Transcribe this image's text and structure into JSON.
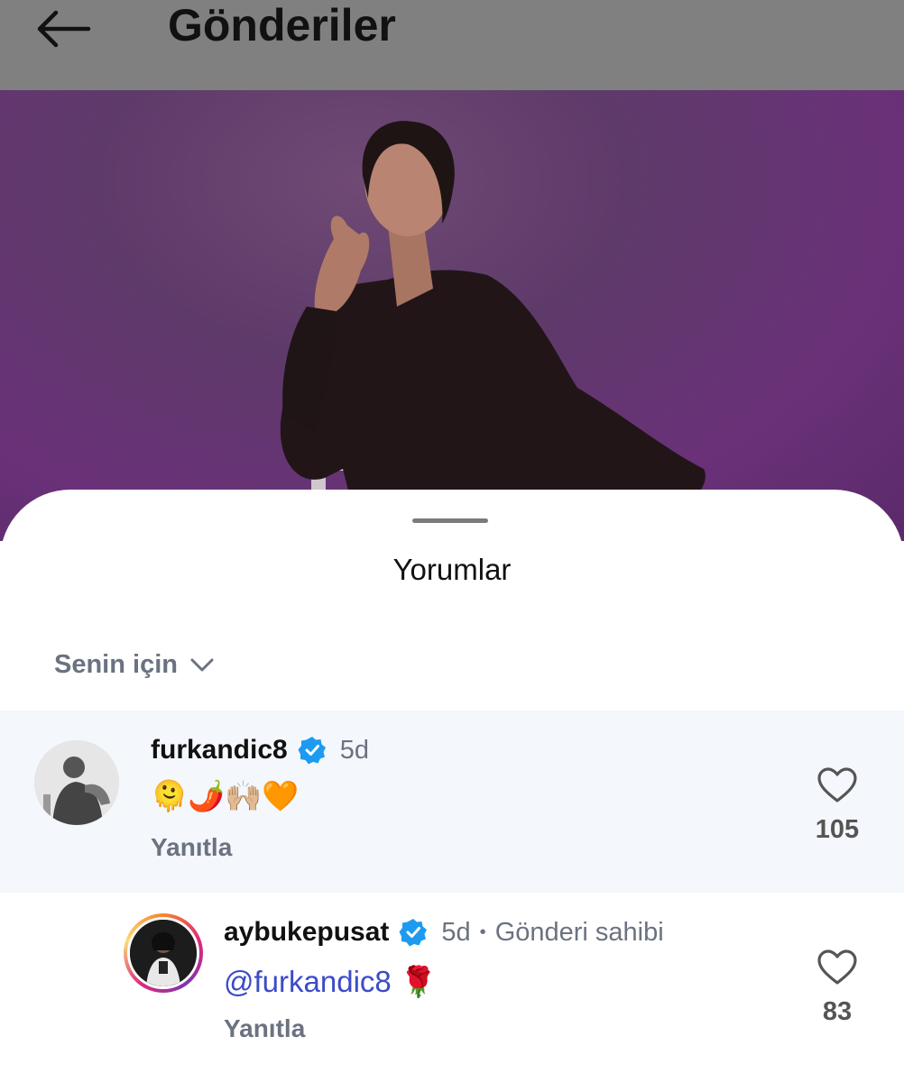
{
  "header": {
    "title": "Gönderiler",
    "back_icon": "arrow-left-icon"
  },
  "colors": {
    "accent_blue": "#3b4bc8",
    "verified_blue": "#1d9bf0",
    "muted_text": "#6b7280",
    "highlight_row": "#f4f7fb"
  },
  "sheet": {
    "title": "Yorumlar",
    "sort": {
      "label": "Senin için",
      "icon": "chevron-down-icon"
    }
  },
  "comments": [
    {
      "username": "furkandic8",
      "verified": true,
      "time": "5d",
      "text": "🫠🌶️🙌🏼🧡",
      "reply_label": "Yanıtla",
      "likes": "105"
    },
    {
      "username": "aybukepusat",
      "verified": true,
      "time": "5d",
      "separator": "•",
      "owner_label": "Gönderi sahibi",
      "mention": "@furkandic8",
      "text": "🌹",
      "reply_label": "Yanıtla",
      "likes": "83"
    }
  ]
}
